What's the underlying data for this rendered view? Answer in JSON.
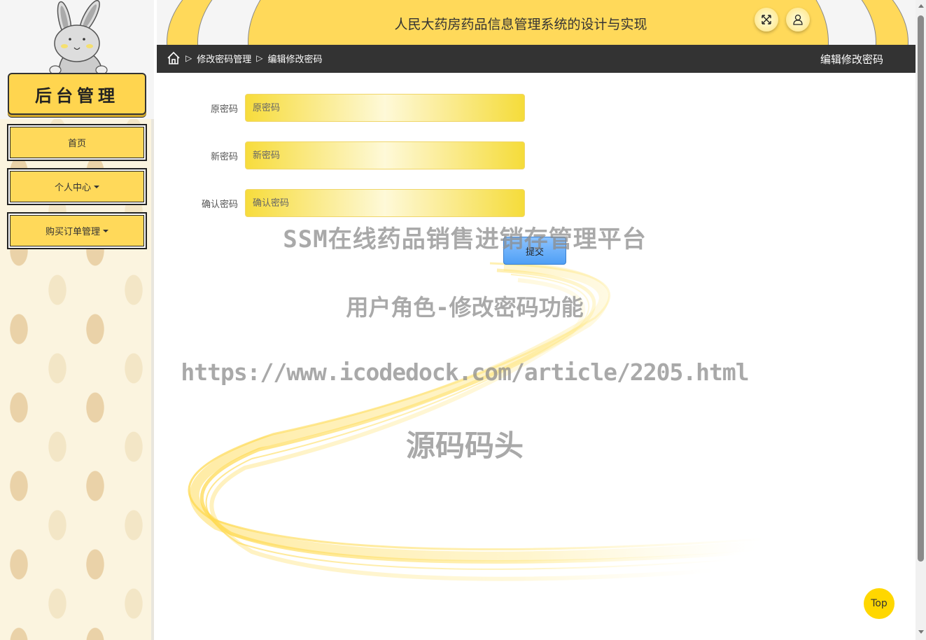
{
  "sidebar": {
    "brand": "后台管理",
    "items": [
      {
        "label": "首页",
        "has_dropdown": false
      },
      {
        "label": "个人中心",
        "has_dropdown": true
      },
      {
        "label": "购买订单管理",
        "has_dropdown": true
      }
    ]
  },
  "header": {
    "title": "人民大药房药品信息管理系统的设计与实现",
    "icons": [
      "fullscreen-icon",
      "user-icon"
    ]
  },
  "breadcrumb": {
    "items": [
      "修改密码管理",
      "编辑修改密码"
    ],
    "current_page": "编辑修改密码"
  },
  "form": {
    "fields": [
      {
        "label": "原密码",
        "placeholder": "原密码",
        "value": ""
      },
      {
        "label": "新密码",
        "placeholder": "新密码",
        "value": ""
      },
      {
        "label": "确认密码",
        "placeholder": "确认密码",
        "value": ""
      }
    ],
    "submit_label": "提交"
  },
  "watermark": {
    "line1": "SSM在线药品销售进销存管理平台",
    "line2": "用户角色-修改密码功能",
    "line3": "https://www.icodedock.com/article/2205.html",
    "line4": "源码码头"
  },
  "back_to_top": "Top",
  "colors": {
    "accent_yellow": "#ffd95a",
    "dark_bar": "#333333",
    "submit_blue": "#4f9ff5"
  }
}
